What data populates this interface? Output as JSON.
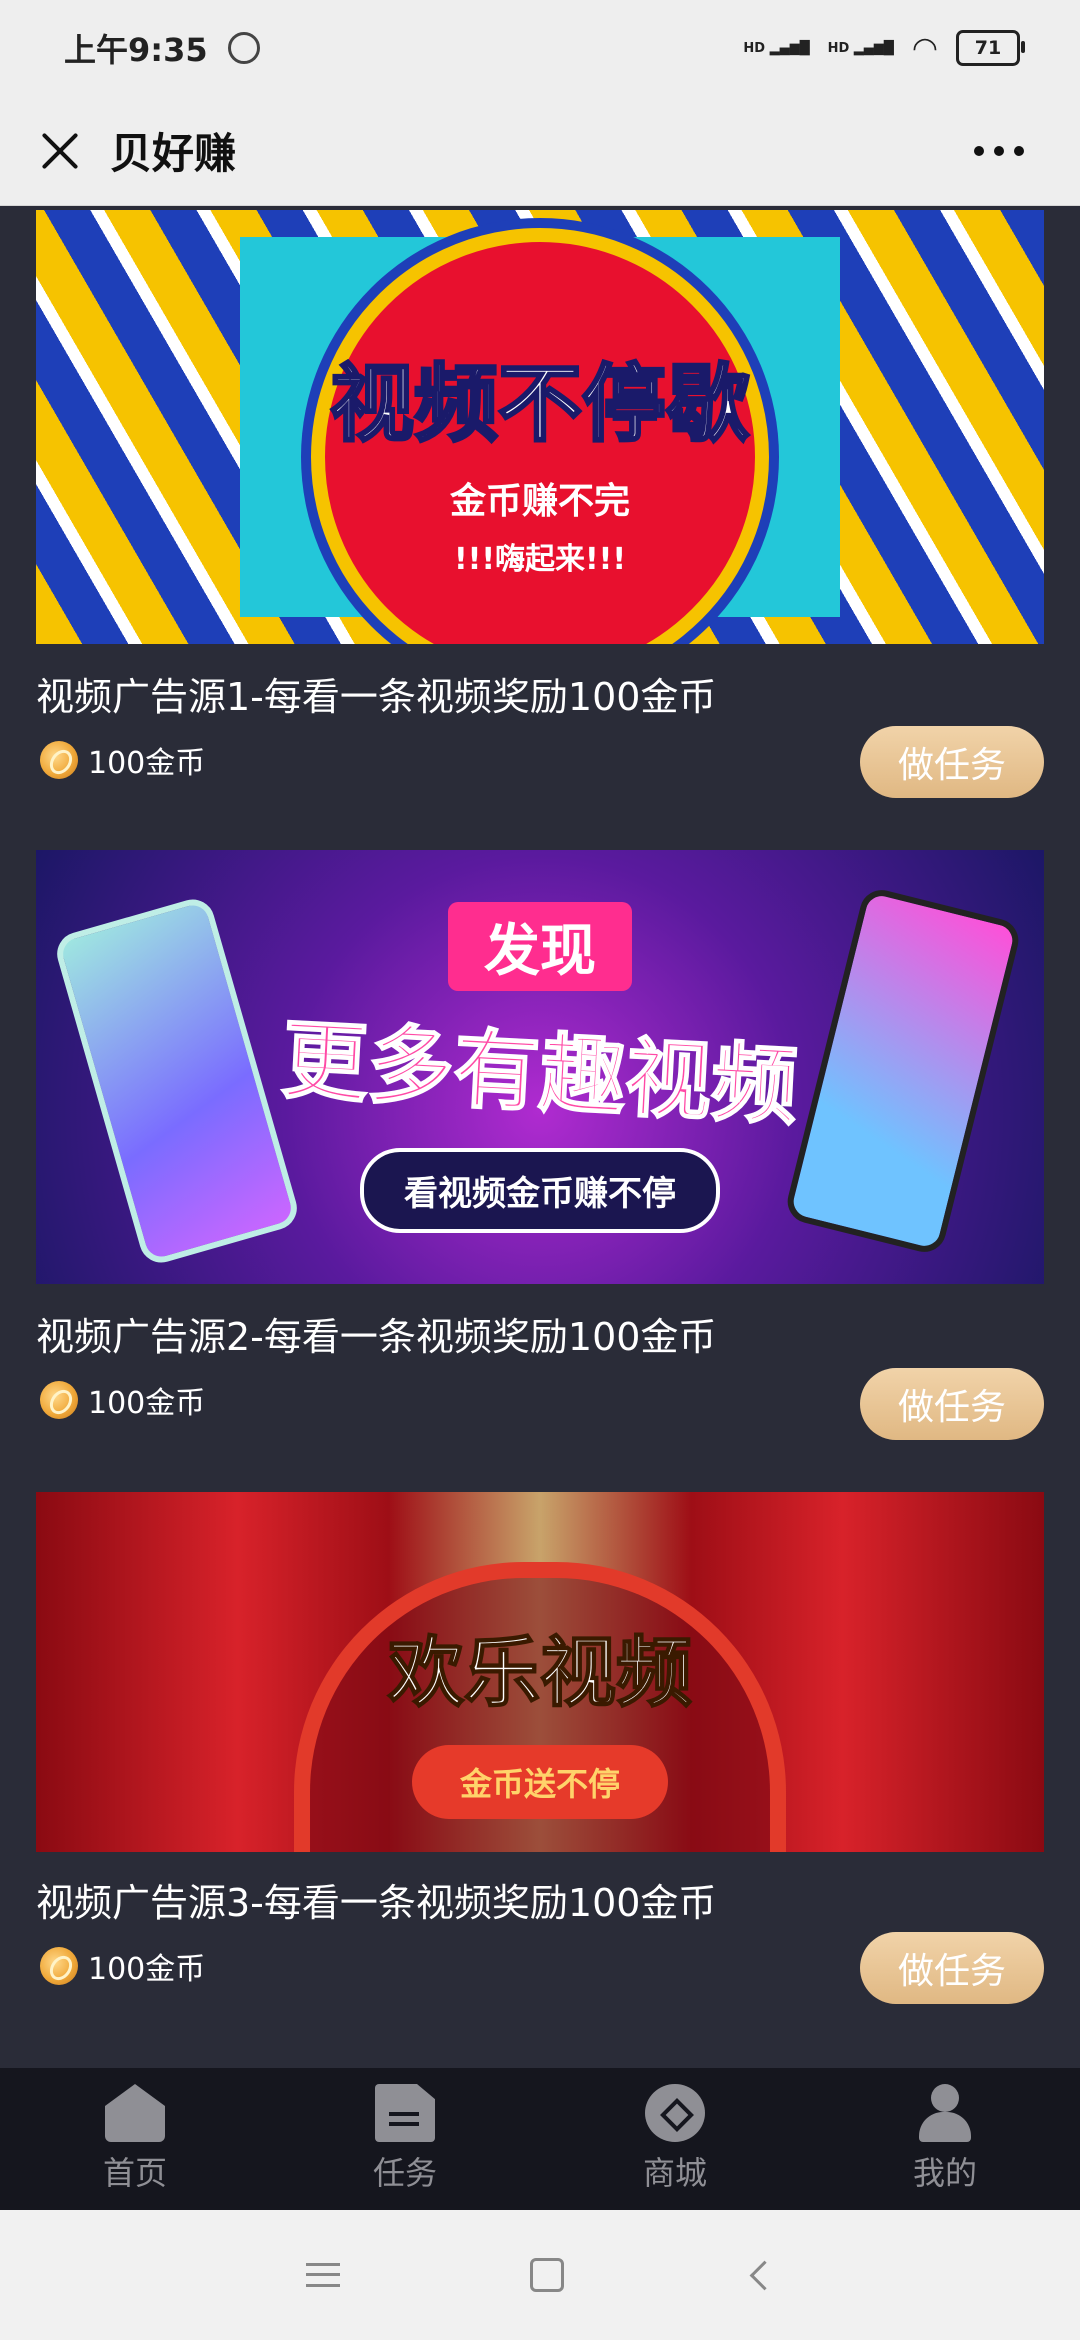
{
  "status_bar": {
    "time": "上午9:35",
    "hd1": "HD",
    "hd2": "HD",
    "battery": "71"
  },
  "app_bar": {
    "title": "贝好赚"
  },
  "tasks": [
    {
      "banner_headline": "视频不停歇",
      "banner_line1": "金币赚不完",
      "banner_line2": "!!!嗨起来!!!",
      "title": "视频广告源1-每看一条视频奖励100金币",
      "reward": "100金币",
      "button": "做任务"
    },
    {
      "banner_tag": "发现",
      "banner_headline": "更多有趣视频",
      "banner_line1": "看视频金币赚不停",
      "title": "视频广告源2-每看一条视频奖励100金币",
      "reward": "100金币",
      "button": "做任务"
    },
    {
      "banner_headline": "欢乐视频",
      "banner_line1": "金币送不停",
      "title": "视频广告源3-每看一条视频奖励100金币",
      "reward": "100金币",
      "button": "做任务"
    }
  ],
  "bottom_nav": [
    {
      "label": "首页",
      "icon": "home-icon"
    },
    {
      "label": "任务",
      "icon": "document-icon"
    },
    {
      "label": "商城",
      "icon": "store-icon"
    },
    {
      "label": "我的",
      "icon": "user-icon"
    }
  ],
  "colors": {
    "background": "#2a2c38",
    "button": "#e7c494",
    "nav_bg": "#15161e"
  }
}
